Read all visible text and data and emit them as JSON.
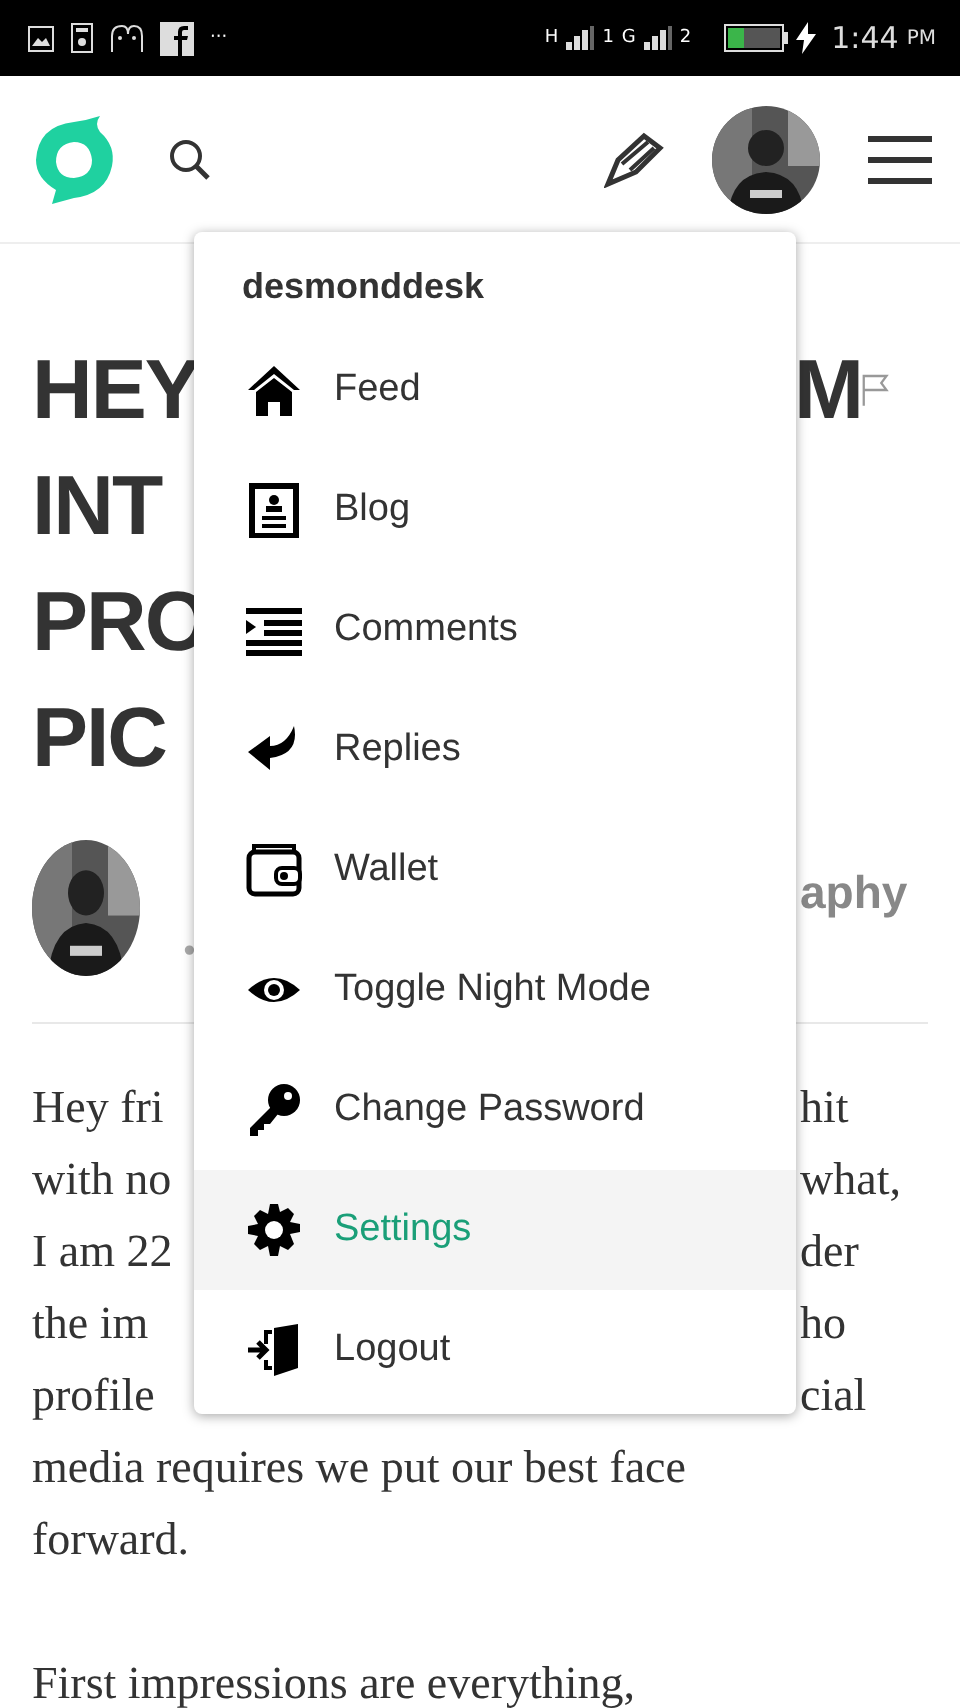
{
  "status_bar": {
    "network_1": "H",
    "network_1_sim": "1",
    "network_2": "G",
    "network_2_sim": "2",
    "more": "···",
    "time": "1:44",
    "ampm": "PM"
  },
  "menu": {
    "username": "desmonddesk",
    "items": [
      {
        "label": "Feed",
        "selected": false
      },
      {
        "label": "Blog",
        "selected": false
      },
      {
        "label": "Comments",
        "selected": false
      },
      {
        "label": "Replies",
        "selected": false
      },
      {
        "label": "Wallet",
        "selected": false
      },
      {
        "label": "Toggle Night Mode",
        "selected": false
      },
      {
        "label": "Change Password",
        "selected": false
      },
      {
        "label": "Settings",
        "selected": true
      },
      {
        "label": "Logout",
        "selected": false
      }
    ]
  },
  "article": {
    "title_lines": [
      {
        "left": "HEY",
        "right": "M"
      },
      {
        "left": "INT"
      },
      {
        "left": "PRO"
      },
      {
        "left": "PIC"
      }
    ],
    "author": {
      "meta": "•",
      "right": "aphy"
    },
    "paragraphs": [
      {
        "lines": [
          {
            "left": "Hey fri",
            "right": "hit"
          },
          {
            "left": "with no",
            "right": "what,"
          },
          {
            "left": "I am 22",
            "right": "der"
          },
          {
            "left": "the im",
            "right": "ho"
          },
          {
            "left": "profile",
            "right": "cial"
          },
          {
            "left": "media requires we put our best face"
          },
          {
            "left": "forward."
          }
        ]
      },
      {
        "lines": [
          {
            "left": "First impressions are everything,"
          }
        ]
      }
    ]
  }
}
